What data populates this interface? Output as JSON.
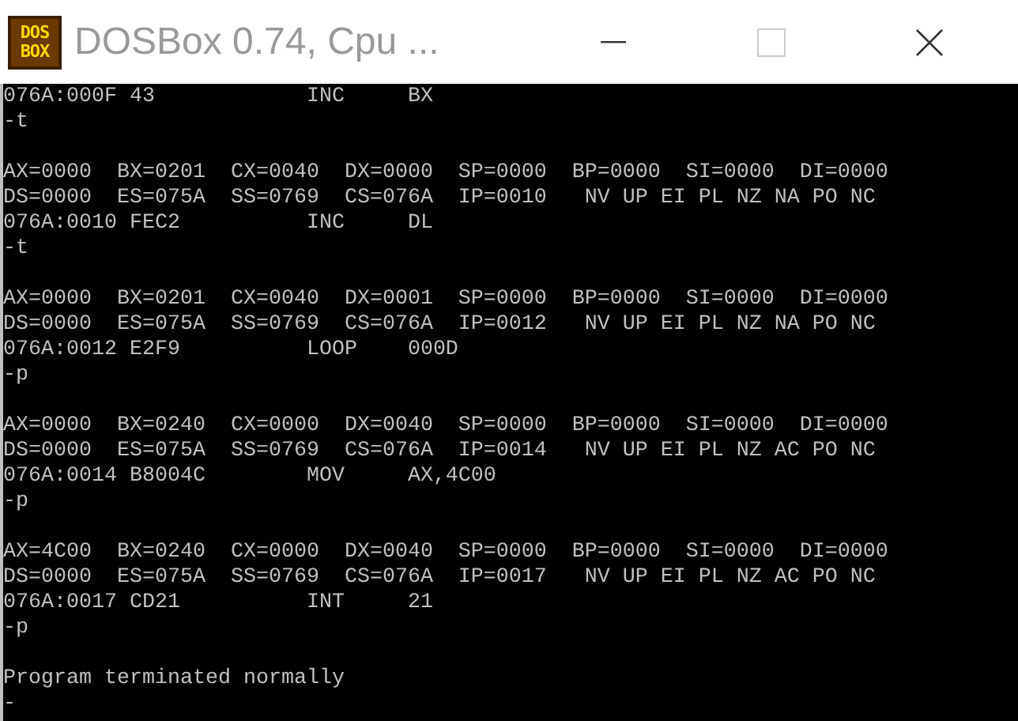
{
  "window": {
    "title": "DOSBox 0.74, Cpu ...",
    "logo_lines": [
      "DOS",
      "BOX"
    ],
    "controls": [
      {
        "kind": "minimize",
        "disabled": false
      },
      {
        "kind": "maximize",
        "disabled": true
      },
      {
        "kind": "close",
        "disabled": false
      }
    ]
  },
  "console": {
    "blocks": [
      {
        "lines": [
          "076A:000F 43            INC     BX",
          "-t"
        ]
      },
      {
        "lines": [
          "AX=0000  BX=0201  CX=0040  DX=0000  SP=0000  BP=0000  SI=0000  DI=0000",
          "DS=0000  ES=075A  SS=0769  CS=076A  IP=0010   NV UP EI PL NZ NA PO NC",
          "076A:0010 FEC2          INC     DL",
          "-t"
        ]
      },
      {
        "lines": [
          "AX=0000  BX=0201  CX=0040  DX=0001  SP=0000  BP=0000  SI=0000  DI=0000",
          "DS=0000  ES=075A  SS=0769  CS=076A  IP=0012   NV UP EI PL NZ NA PO NC",
          "076A:0012 E2F9          LOOP    000D",
          "-p"
        ]
      },
      {
        "lines": [
          "AX=0000  BX=0240  CX=0000  DX=0040  SP=0000  BP=0000  SI=0000  DI=0000",
          "DS=0000  ES=075A  SS=0769  CS=076A  IP=0014   NV UP EI PL NZ AC PO NC",
          "076A:0014 B8004C        MOV     AX,4C00",
          "-p"
        ]
      },
      {
        "lines": [
          "AX=4C00  BX=0240  CX=0000  DX=0040  SP=0000  BP=0000  SI=0000  DI=0000",
          "DS=0000  ES=075A  SS=0769  CS=076A  IP=0017   NV UP EI PL NZ AC PO NC",
          "076A:0017 CD21          INT     21",
          "-p"
        ]
      },
      {
        "lines": [
          "Program terminated normally",
          "-"
        ]
      }
    ]
  }
}
